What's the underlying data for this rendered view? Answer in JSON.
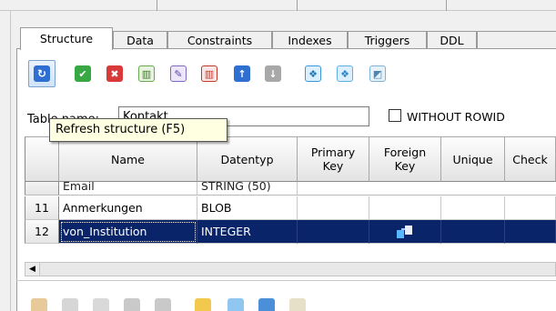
{
  "tabs": [
    {
      "label": "Structure",
      "active": true
    },
    {
      "label": "Data",
      "active": false
    },
    {
      "label": "Constraints",
      "active": false
    },
    {
      "label": "Indexes",
      "active": false
    },
    {
      "label": "Triggers",
      "active": false
    },
    {
      "label": "DDL",
      "active": false
    }
  ],
  "toolbar": {
    "buttons": [
      {
        "icon": "refresh-icon",
        "glyph": "↻",
        "color": "#2f6fd1",
        "pressed": true
      },
      {
        "icon": "commit-icon",
        "glyph": "✔",
        "color": "#37a843"
      },
      {
        "icon": "rollback-icon",
        "glyph": "✖",
        "color": "#d83a3a"
      },
      {
        "icon": "add-column-icon",
        "glyph": "Ⅱ",
        "color": "#6aa84f"
      },
      {
        "icon": "edit-column-icon",
        "glyph": "✎",
        "color": "#7d6bc4"
      },
      {
        "icon": "delete-column-icon",
        "glyph": "Ⅱ",
        "color": "#c0392b"
      },
      {
        "icon": "move-up-icon",
        "glyph": "↑",
        "color": "#2f6fd1"
      },
      {
        "icon": "move-down-icon",
        "glyph": "↓",
        "color": "#9a9a9a"
      },
      {
        "icon": "primary-key-icon",
        "glyph": "❖",
        "color": "#3a9ad9"
      },
      {
        "icon": "foreign-key-icon",
        "glyph": "❖",
        "color": "#5bb0e6"
      },
      {
        "icon": "unique-icon",
        "glyph": "◩",
        "color": "#7fb3d5"
      }
    ]
  },
  "table_name": {
    "label": "Table name:",
    "value": "Kontakt"
  },
  "without_rowid": {
    "label": "WITHOUT ROWID",
    "checked": false
  },
  "tooltip": {
    "text": "Refresh structure (F5)"
  },
  "grid": {
    "columns": [
      "Name",
      "Datentyp",
      "Primary\nKey",
      "Foreign\nKey",
      "Unique",
      "Check"
    ],
    "partial_row": {
      "name": "Email",
      "type": "STRING (50)"
    },
    "rows": [
      {
        "num": "11",
        "name": "Anmerkungen",
        "type": "BLOB",
        "primary_key": "",
        "foreign_key": false,
        "unique": "",
        "check": "",
        "selected": false
      },
      {
        "num": "12",
        "name": "von_Institution",
        "type": "INTEGER",
        "primary_key": "",
        "foreign_key": true,
        "unique": "",
        "check": "",
        "selected": true
      }
    ]
  },
  "colors": {
    "selection": "#0a246a",
    "tooltip_bg": "#ffffe1"
  }
}
